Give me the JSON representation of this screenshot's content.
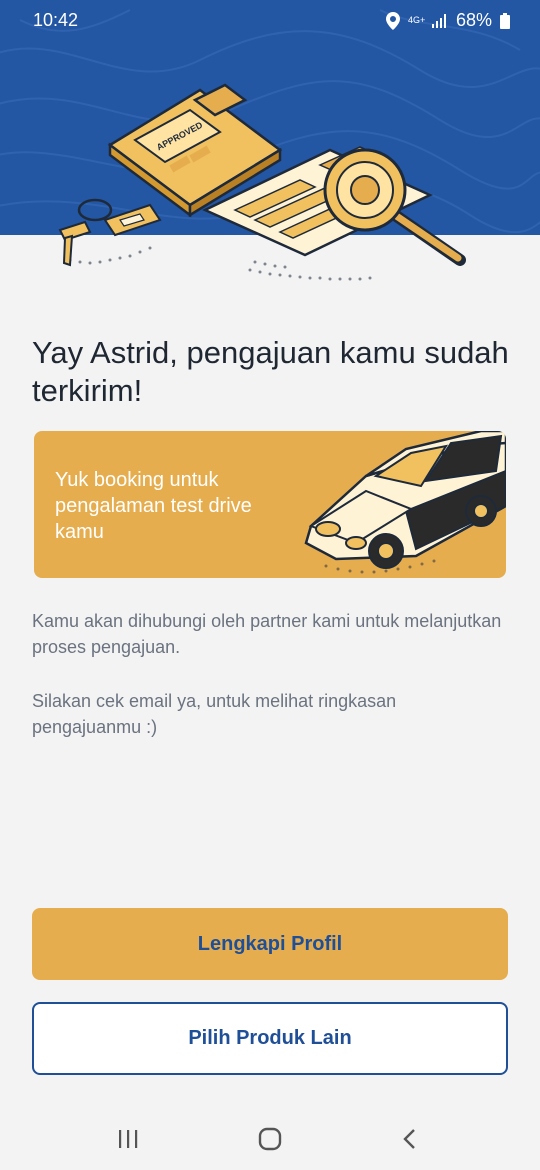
{
  "status_bar": {
    "time": "10:42",
    "network": "4G+",
    "battery": "68%"
  },
  "hero": {
    "illustration": "approved-clipboard-with-keys-and-magnifier",
    "stamp_text": "APPROVED"
  },
  "title": "Yay Astrid, pengajuan kamu sudah terkirim!",
  "promo": {
    "text": "Yuk booking untuk pengalaman test drive kamu",
    "illustration": "car-icon"
  },
  "body": {
    "paragraph_1": "Kamu akan dihubungi oleh partner kami untuk melanjutkan proses pengajuan.",
    "paragraph_2": "Silakan cek email ya, untuk melihat ringkasan pengajuanmu :)"
  },
  "buttons": {
    "primary_label": "Lengkapi Profil",
    "secondary_label": "Pilih Produk Lain"
  },
  "navbar": {
    "items": [
      "recent-apps-icon",
      "home-icon",
      "back-icon"
    ]
  },
  "colors": {
    "header_blue": "#2356a3",
    "accent_orange": "#e6ad4e",
    "button_text": "#1f4f97",
    "background": "#f3f3f3"
  }
}
